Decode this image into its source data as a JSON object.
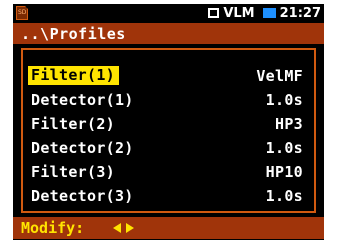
{
  "status": {
    "sd_icon": "sd-card-icon",
    "sd_label": "SD",
    "mode_icon": "mode-box-icon",
    "mode": "VLM",
    "battery_icon": "battery-icon",
    "time": "21:27"
  },
  "title": "..\\Profiles",
  "rows": [
    {
      "label": "Filter(1)",
      "value": "VelMF",
      "selected": true
    },
    {
      "label": "Detector(1)",
      "value": "1.0s"
    },
    {
      "label": "Filter(2)",
      "value": "HP3"
    },
    {
      "label": "Detector(2)",
      "value": "1.0s"
    },
    {
      "label": "Filter(3)",
      "value": "HP10"
    },
    {
      "label": "Detector(3)",
      "value": "1.0s"
    }
  ],
  "hint": {
    "text": "Modify:",
    "left_icon": "arrow-left-icon",
    "right_icon": "arrow-right-icon"
  },
  "colors": {
    "background": "#000000",
    "title_bar": "#a0340a",
    "frame": "#d15a10",
    "highlight": "#ffe400",
    "text": "#ffffff",
    "battery": "#1e90ff"
  }
}
